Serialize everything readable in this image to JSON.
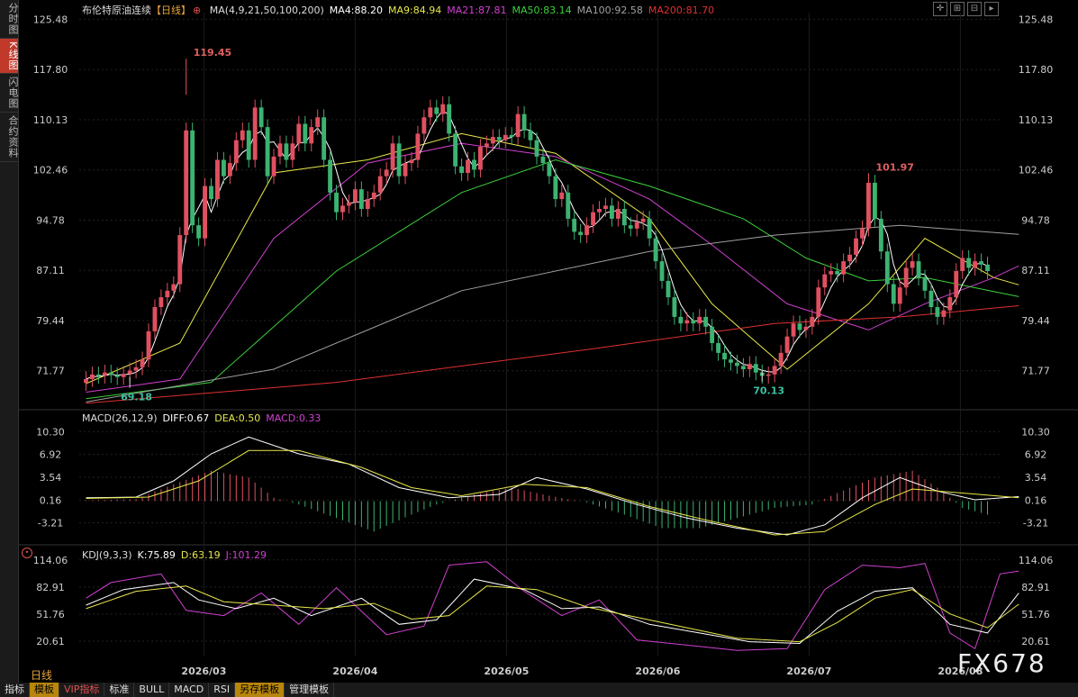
{
  "app": {
    "instrument": "布伦特原油连续",
    "period_tag": "【日线】",
    "period_label": "日线",
    "watermark": "FX678"
  },
  "left_tabs": [
    "分时图",
    "K线图",
    "闪电图",
    "合约资料"
  ],
  "bottom_tabs": [
    "指标",
    "模板",
    "VIP指标",
    "标准",
    "BULL",
    "MACD",
    "RSI",
    "另存模板",
    "管理模板"
  ],
  "legends": {
    "ma": [
      {
        "text": "MA(4,9,21,50,100,200)",
        "color": "#dddddd"
      },
      {
        "text": "MA4:88.20",
        "color": "#ffffff"
      },
      {
        "text": "MA9:84.94",
        "color": "#e8e84a"
      },
      {
        "text": "MA21:87.81",
        "color": "#d040d0"
      },
      {
        "text": "MA50:83.14",
        "color": "#3cd03c"
      },
      {
        "text": "MA100:92.58",
        "color": "#a0a0a0"
      },
      {
        "text": "MA200:81.70",
        "color": "#e03030"
      }
    ],
    "macd": [
      {
        "text": "MACD(26,12,9)",
        "color": "#dddddd"
      },
      {
        "text": "DIFF:0.67",
        "color": "#ffffff"
      },
      {
        "text": "DEA:0.50",
        "color": "#e8e84a"
      },
      {
        "text": "MACD:0.33",
        "color": "#d040d0"
      }
    ],
    "kdj": [
      {
        "text": "KDJ(9,3,3)",
        "color": "#dddddd"
      },
      {
        "text": "K:75.89",
        "color": "#ffffff"
      },
      {
        "text": "D:63.19",
        "color": "#e8e84a"
      },
      {
        "text": "J:101.29",
        "color": "#d040d0"
      }
    ]
  },
  "chart_data": {
    "type": "candlestick",
    "x_labels": [
      "2026/03",
      "2026/04",
      "2026/05",
      "2026/06",
      "2026/07",
      "2026/08"
    ],
    "price_axis": {
      "ticks": [
        125.48,
        117.8,
        110.13,
        102.46,
        94.78,
        87.11,
        79.44,
        71.77
      ],
      "range": [
        66.5,
        126.5
      ]
    },
    "macd_axis": {
      "ticks": [
        10.3,
        6.92,
        3.54,
        0.16,
        -3.21
      ],
      "range": [
        -5.8,
        11.8
      ]
    },
    "kdj_axis": {
      "ticks": [
        114.06,
        82.91,
        51.76,
        20.61
      ],
      "range": [
        4,
        118
      ]
    },
    "annotations": [
      {
        "text": "119.45",
        "value": 119.45,
        "color": "#e06060"
      },
      {
        "text": "69.18",
        "value": 69.18,
        "color": "#3cc0a0"
      },
      {
        "text": "101.97",
        "value": 101.97,
        "color": "#e06060"
      },
      {
        "text": "70.13",
        "value": 70.13,
        "color": "#3cc0a0"
      }
    ],
    "close": [
      70.5,
      71.2,
      71.0,
      71.5,
      71.1,
      70.8,
      71.3,
      71.8,
      72.3,
      73.5,
      77.8,
      81.5,
      83.0,
      84.0,
      85.0,
      92.5,
      108.5,
      94.0,
      92.0,
      100.0,
      98.0,
      104.0,
      101.5,
      103.5,
      107.0,
      108.5,
      104.0,
      112.0,
      109.0,
      101.5,
      104.5,
      106.5,
      104.0,
      106.5,
      109.5,
      106.5,
      109.0,
      110.5,
      104.0,
      99.0,
      96.0,
      97.0,
      97.5,
      99.5,
      96.5,
      98.0,
      99.0,
      101.5,
      102.5,
      106.5,
      101.5,
      103.5,
      104.0,
      108.0,
      110.5,
      112.0,
      111.0,
      112.5,
      108.0,
      103.0,
      102.0,
      104.0,
      102.5,
      106.0,
      106.5,
      107.5,
      107.0,
      107.8,
      107.5,
      111.0,
      108.5,
      107.0,
      104.5,
      103.5,
      101.5,
      98.0,
      99.0,
      95.0,
      93.0,
      92.5,
      94.0,
      96.0,
      96.5,
      97.0,
      95.0,
      96.5,
      94.0,
      93.5,
      94.5,
      95.0,
      92.0,
      88.5,
      85.5,
      83.0,
      80.0,
      79.0,
      79.5,
      79.0,
      80.0,
      78.5,
      76.0,
      74.5,
      73.5,
      73.0,
      72.5,
      72.0,
      72.8,
      71.5,
      71.0,
      71.2,
      72.5,
      74.5,
      77.0,
      79.0,
      78.0,
      78.5,
      80.0,
      84.5,
      86.5,
      87.0,
      86.5,
      88.5,
      89.5,
      92.0,
      93.5,
      100.5,
      95.0,
      90.0,
      85.0,
      82.0,
      84.5,
      87.5,
      88.5,
      86.0,
      84.0,
      81.5,
      80.0,
      81.0,
      83.0,
      87.0,
      89.0,
      87.5,
      88.5,
      88.0,
      87.0
    ],
    "ma": {
      "MA9": [
        [
          0,
          69.8
        ],
        [
          15,
          76
        ],
        [
          30,
          102
        ],
        [
          45,
          104
        ],
        [
          60,
          108
        ],
        [
          75,
          105
        ],
        [
          90,
          95
        ],
        [
          100,
          82
        ],
        [
          112,
          72
        ],
        [
          125,
          82
        ],
        [
          134,
          92
        ],
        [
          145,
          86
        ],
        [
          149,
          84.9
        ]
      ],
      "MA21": [
        [
          0,
          68.5
        ],
        [
          15,
          70.5
        ],
        [
          30,
          92
        ],
        [
          45,
          103.5
        ],
        [
          60,
          106.5
        ],
        [
          75,
          104.5
        ],
        [
          90,
          98
        ],
        [
          100,
          91
        ],
        [
          112,
          82
        ],
        [
          125,
          78
        ],
        [
          134,
          82
        ],
        [
          145,
          86
        ],
        [
          149,
          87.8
        ]
      ],
      "MA50": [
        [
          0,
          67.5
        ],
        [
          20,
          70
        ],
        [
          40,
          87
        ],
        [
          60,
          99
        ],
        [
          75,
          104
        ],
        [
          90,
          100
        ],
        [
          105,
          95
        ],
        [
          115,
          89
        ],
        [
          125,
          85.5
        ],
        [
          134,
          86
        ],
        [
          149,
          83.1
        ]
      ],
      "MA100": [
        [
          0,
          67.0
        ],
        [
          30,
          72
        ],
        [
          60,
          84
        ],
        [
          90,
          90
        ],
        [
          110,
          92.5
        ],
        [
          130,
          94
        ],
        [
          149,
          92.6
        ]
      ],
      "MA200": [
        [
          0,
          66.8
        ],
        [
          40,
          70
        ],
        [
          80,
          75
        ],
        [
          110,
          79
        ],
        [
          130,
          80
        ],
        [
          149,
          81.7
        ]
      ]
    },
    "macd": {
      "diff": [
        [
          0,
          0.5
        ],
        [
          8,
          0.6
        ],
        [
          14,
          3.0
        ],
        [
          20,
          7.0
        ],
        [
          26,
          9.5
        ],
        [
          34,
          7.0
        ],
        [
          42,
          5.5
        ],
        [
          50,
          2.0
        ],
        [
          58,
          0.5
        ],
        [
          66,
          1.0
        ],
        [
          72,
          3.5
        ],
        [
          80,
          1.8
        ],
        [
          88,
          -0.5
        ],
        [
          96,
          -2.5
        ],
        [
          104,
          -4.0
        ],
        [
          112,
          -5.0
        ],
        [
          118,
          -3.5
        ],
        [
          124,
          0.5
        ],
        [
          130,
          3.5
        ],
        [
          136,
          1.5
        ],
        [
          142,
          0.2
        ],
        [
          149,
          0.67
        ]
      ],
      "dea": [
        [
          0,
          0.4
        ],
        [
          10,
          0.6
        ],
        [
          18,
          3.0
        ],
        [
          26,
          7.5
        ],
        [
          34,
          7.5
        ],
        [
          44,
          5.0
        ],
        [
          52,
          2.0
        ],
        [
          60,
          0.8
        ],
        [
          70,
          2.5
        ],
        [
          80,
          2.0
        ],
        [
          90,
          -0.8
        ],
        [
          100,
          -3.0
        ],
        [
          110,
          -5.0
        ],
        [
          118,
          -4.5
        ],
        [
          126,
          -0.5
        ],
        [
          132,
          1.8
        ],
        [
          140,
          1.2
        ],
        [
          149,
          0.5
        ]
      ],
      "hist": [
        [
          0,
          0.1
        ],
        [
          8,
          0.3
        ],
        [
          14,
          2.5
        ],
        [
          20,
          4.5
        ],
        [
          26,
          3.5
        ],
        [
          30,
          0.5
        ],
        [
          34,
          -0.5
        ],
        [
          40,
          -2.5
        ],
        [
          46,
          -4.5
        ],
        [
          52,
          -2.0
        ],
        [
          56,
          -0.5
        ],
        [
          62,
          1.0
        ],
        [
          68,
          2.0
        ],
        [
          74,
          0.8
        ],
        [
          80,
          -0.2
        ],
        [
          86,
          -2.0
        ],
        [
          92,
          -4.0
        ],
        [
          98,
          -4.0
        ],
        [
          104,
          -2.5
        ],
        [
          110,
          -1.0
        ],
        [
          116,
          -0.5
        ],
        [
          120,
          1.2
        ],
        [
          126,
          3.5
        ],
        [
          132,
          4.5
        ],
        [
          136,
          2.0
        ],
        [
          140,
          -1.0
        ],
        [
          144,
          -2.0
        ],
        [
          149,
          0.33
        ]
      ]
    },
    "kdj": {
      "K": [
        [
          0,
          62
        ],
        [
          6,
          80
        ],
        [
          14,
          88
        ],
        [
          18,
          68
        ],
        [
          24,
          58
        ],
        [
          30,
          70
        ],
        [
          36,
          50
        ],
        [
          44,
          70
        ],
        [
          50,
          40
        ],
        [
          56,
          45
        ],
        [
          62,
          92
        ],
        [
          70,
          80
        ],
        [
          76,
          58
        ],
        [
          82,
          60
        ],
        [
          90,
          40
        ],
        [
          98,
          30
        ],
        [
          106,
          20
        ],
        [
          114,
          18
        ],
        [
          120,
          55
        ],
        [
          126,
          78
        ],
        [
          132,
          82
        ],
        [
          138,
          40
        ],
        [
          144,
          30
        ],
        [
          149,
          75.9
        ]
      ],
      "D": [
        [
          0,
          58
        ],
        [
          8,
          78
        ],
        [
          16,
          84
        ],
        [
          22,
          66
        ],
        [
          30,
          62
        ],
        [
          38,
          58
        ],
        [
          46,
          64
        ],
        [
          52,
          46
        ],
        [
          58,
          50
        ],
        [
          64,
          84
        ],
        [
          72,
          80
        ],
        [
          80,
          60
        ],
        [
          88,
          48
        ],
        [
          96,
          36
        ],
        [
          104,
          24
        ],
        [
          114,
          20
        ],
        [
          120,
          42
        ],
        [
          126,
          70
        ],
        [
          132,
          80
        ],
        [
          138,
          52
        ],
        [
          144,
          36
        ],
        [
          149,
          63.2
        ]
      ],
      "J": [
        [
          0,
          70
        ],
        [
          4,
          88
        ],
        [
          12,
          98
        ],
        [
          16,
          56
        ],
        [
          22,
          50
        ],
        [
          28,
          76
        ],
        [
          34,
          40
        ],
        [
          40,
          82
        ],
        [
          48,
          28
        ],
        [
          54,
          38
        ],
        [
          58,
          108
        ],
        [
          64,
          112
        ],
        [
          70,
          78
        ],
        [
          76,
          50
        ],
        [
          82,
          68
        ],
        [
          88,
          22
        ],
        [
          96,
          16
        ],
        [
          104,
          10
        ],
        [
          112,
          12
        ],
        [
          118,
          80
        ],
        [
          124,
          108
        ],
        [
          130,
          105
        ],
        [
          134,
          110
        ],
        [
          138,
          30
        ],
        [
          142,
          12
        ],
        [
          146,
          98
        ],
        [
          149,
          101.3
        ]
      ]
    }
  }
}
